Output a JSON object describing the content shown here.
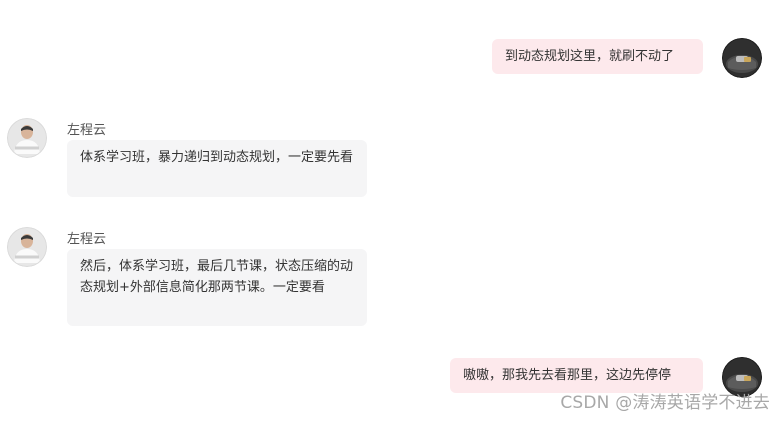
{
  "messages": [
    {
      "side": "self",
      "text": "到动态规划这里，就刷不动了"
    },
    {
      "side": "other",
      "sender": "左程云",
      "text": "体系学习班，暴力递归到动态规划，一定要先看"
    },
    {
      "side": "other",
      "sender": "左程云",
      "text": "然后，体系学习班，最后几节课，状态压缩的动态规划+外部信息简化那两节课。一定要看"
    },
    {
      "side": "self",
      "text": "嗷嗷，那我先去看那里，这边先停停"
    }
  ],
  "watermark": "CSDN @涛涛英语学不进去"
}
